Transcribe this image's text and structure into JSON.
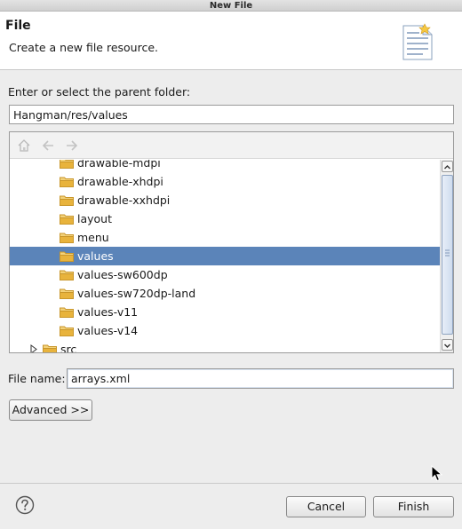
{
  "window": {
    "title": "New File"
  },
  "header": {
    "title": "File",
    "description": "Create a new file resource."
  },
  "parent_folder": {
    "label": "Enter or select the parent folder:",
    "value": "Hangman/res/values"
  },
  "tree": {
    "toolbar": [
      "home-icon",
      "back-arrow-icon",
      "forward-arrow-icon"
    ],
    "items": [
      {
        "label": "drawable-mdpi"
      },
      {
        "label": "drawable-xhdpi"
      },
      {
        "label": "drawable-xxhdpi"
      },
      {
        "label": "layout"
      },
      {
        "label": "menu"
      },
      {
        "label": "values",
        "selected": true
      },
      {
        "label": "values-sw600dp"
      },
      {
        "label": "values-sw720dp-land"
      },
      {
        "label": "values-v11"
      },
      {
        "label": "values-v14"
      },
      {
        "label": "src",
        "collapsed": true
      }
    ]
  },
  "file_name": {
    "label": "File name:",
    "value": "arrays.xml"
  },
  "buttons": {
    "advanced": "Advanced >>",
    "cancel": "Cancel",
    "finish": "Finish"
  },
  "colors": {
    "selection": "#5b84b9",
    "folder": "#e8b33c"
  }
}
